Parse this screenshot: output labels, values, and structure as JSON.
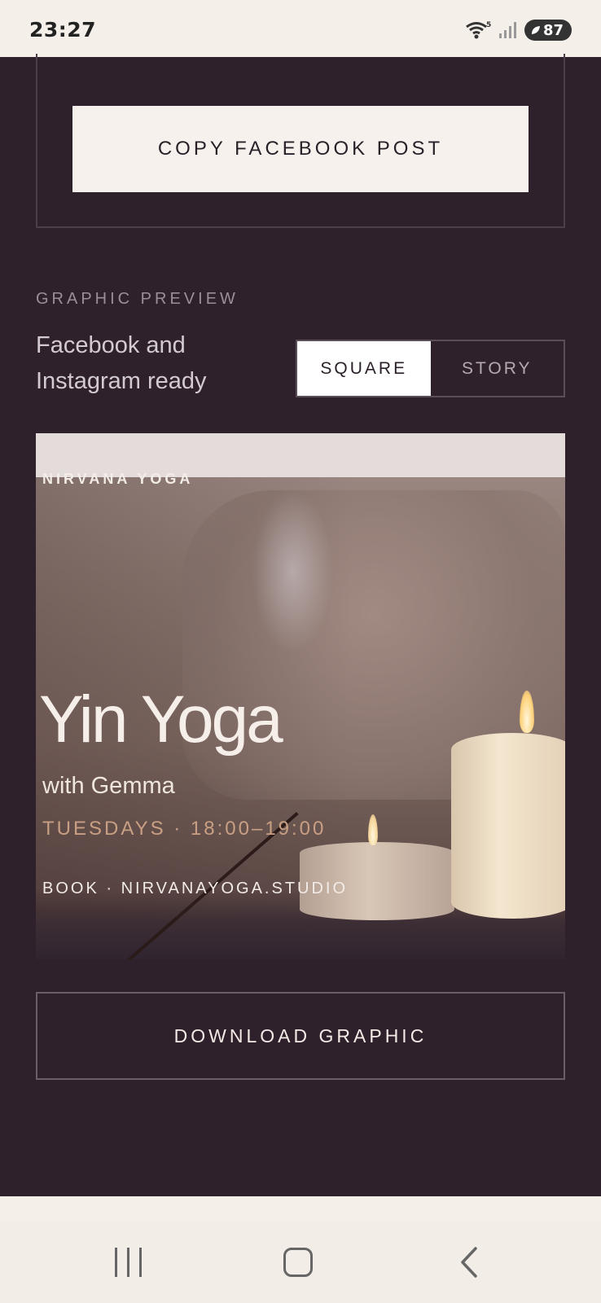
{
  "status_bar": {
    "time": "23:27",
    "network_label": "5",
    "battery": "87",
    "icons": [
      "wifi-icon",
      "signal-icon",
      "battery-icon"
    ]
  },
  "facebook_section": {
    "copy_button_label": "COPY FACEBOOK POST"
  },
  "graphic_preview": {
    "section_label": "GRAPHIC PREVIEW",
    "subtitle_line1": "Facebook and",
    "subtitle_line2": "Instagram ready",
    "format_options": [
      {
        "label": "SQUARE",
        "selected": true
      },
      {
        "label": "STORY",
        "selected": false
      }
    ]
  },
  "graphic": {
    "brand": "NIRVANA YOGA",
    "class_title": "Yin Yoga",
    "instructor": "with Gemma",
    "schedule": "TUESDAYS · 18:00–19:00",
    "booking": "BOOK · NIRVANAYOGA.STUDIO"
  },
  "actions": {
    "download_label": "DOWNLOAD GRAPHIC"
  },
  "colors": {
    "background": "#2e212c",
    "button_light": "#f6f1ec",
    "accent_time": "#c99f84"
  },
  "nav_bar": {
    "icons": [
      "recent-apps-icon",
      "home-icon",
      "back-icon"
    ]
  }
}
